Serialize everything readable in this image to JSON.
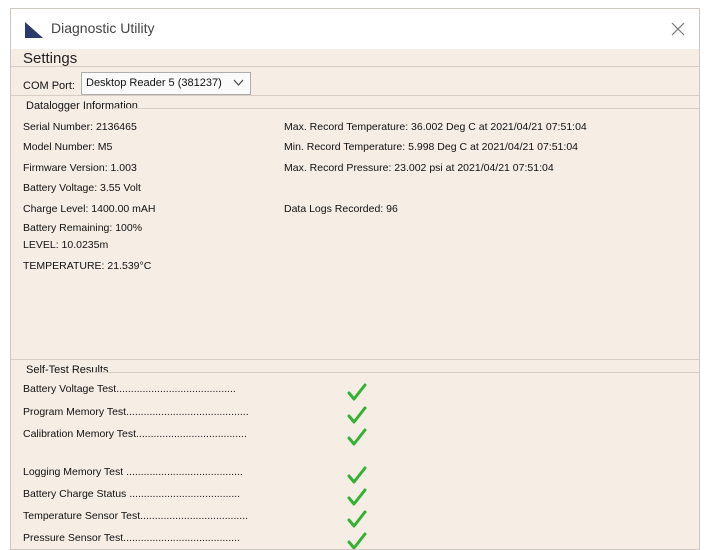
{
  "window": {
    "title": "Diagnostic Utility"
  },
  "settings": {
    "heading": "Settings",
    "com_port_label": "COM Port:",
    "com_port_value": "Desktop Reader 5 (381237)"
  },
  "datalogger": {
    "group_title": "Datalogger Information",
    "left": [
      "Serial Number: 2136465",
      "Model Number: M5",
      "Firmware Version: 1.003",
      "Battery Voltage: 3.55 Volt",
      "Charge Level: 1400.00 mAH",
      "Battery Remaining: 100%",
      "LEVEL: 10.0235m",
      "TEMPERATURE: 21.539°C"
    ],
    "right": [
      "Max. Record Temperature: 36.002 Deg C at 2021/04/21 07:51:04",
      "Min. Record Temperature: 5.998 Deg C at 2021/04/21 07:51:04",
      "Max. Record Pressure: 23.002 psi at 2021/04/21 07:51:04",
      "Data Logs Recorded: 96"
    ]
  },
  "self_test": {
    "group_title": "Self-Test Results",
    "tests": [
      {
        "label": "Battery Voltage Test.........................................",
        "result": "pass"
      },
      {
        "label": "Program Memory Test..........................................",
        "result": "pass"
      },
      {
        "label": "Calibration Memory Test......................................",
        "result": "pass"
      },
      {
        "label": "Logging Memory Test ........................................",
        "result": "pass"
      },
      {
        "label": "Battery Charge Status ......................................",
        "result": "pass"
      },
      {
        "label": "Temperature Sensor Test.....................................",
        "result": "pass"
      },
      {
        "label": "Pressure Sensor Test........................................",
        "result": "pass"
      }
    ]
  },
  "colors": {
    "check": "#33b233",
    "window_bg": "#f6ede5"
  }
}
